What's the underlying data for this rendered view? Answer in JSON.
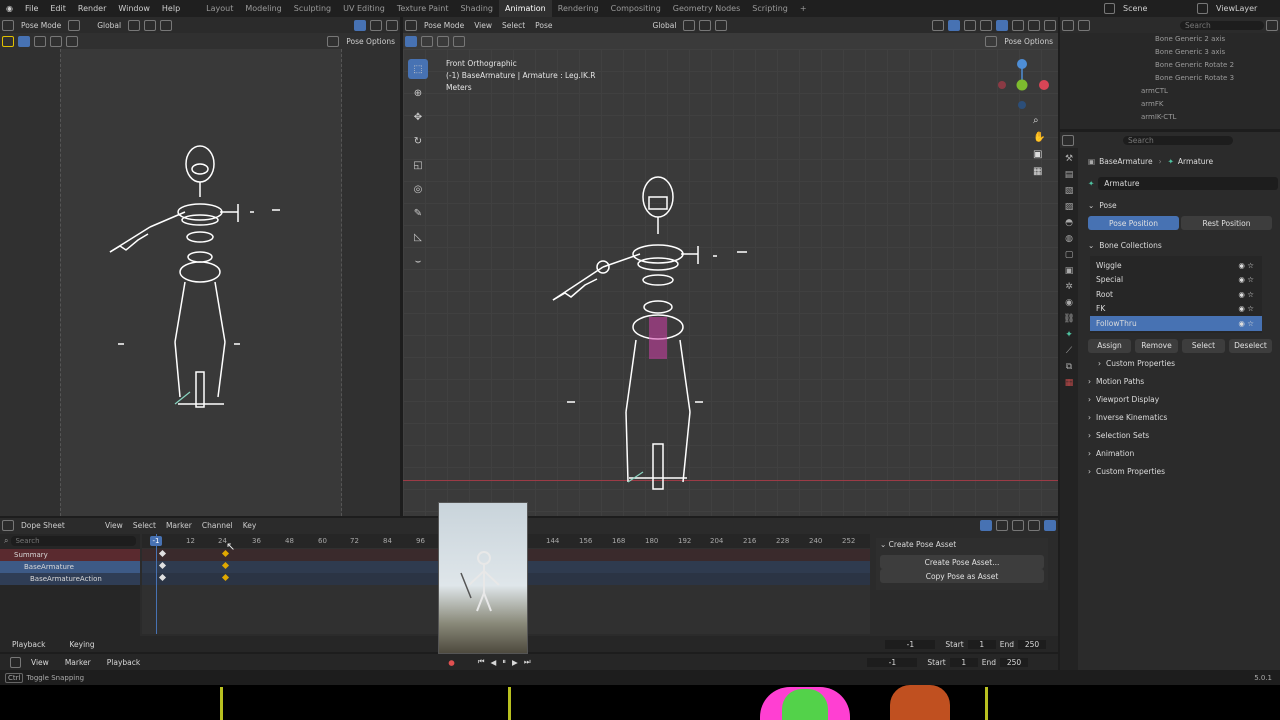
{
  "topbar": {
    "menus": [
      "File",
      "Edit",
      "Render",
      "Window",
      "Help"
    ],
    "workspaces": [
      "Layout",
      "Modeling",
      "Sculpting",
      "UV Editing",
      "Texture Paint",
      "Shading",
      "Animation",
      "Rendering",
      "Compositing",
      "Geometry Nodes",
      "Scripting"
    ],
    "active_workspace": "Animation",
    "add_tab": "+",
    "scene": "Scene",
    "view_layer": "ViewLayer"
  },
  "left_viewport": {
    "mode": "Pose Mode",
    "orientation": "Global",
    "pose_options": "Pose Options"
  },
  "main_viewport": {
    "mode": "Pose Mode",
    "menus": [
      "View",
      "Select",
      "Pose"
    ],
    "orientation": "Global",
    "pose_options": "Pose Options",
    "info_view": "Front Orthographic",
    "info_object": "(-1) BaseArmature | Armature : Leg.IK.R",
    "info_units": "Meters"
  },
  "outliner": {
    "search_placeholder": "Search",
    "items": [
      "Bone Generic 2 axis",
      "Bone Generic 3 axis",
      "Bone Generic Rotate 2",
      "Bone Generic Rotate 3",
      "armCTL",
      "armFK",
      "armIK-CTL"
    ]
  },
  "properties": {
    "search_placeholder": "Search",
    "breadcrumb_object": "BaseArmature",
    "breadcrumb_data": "Armature",
    "data_name": "Armature",
    "pose_panel": "Pose",
    "pose_position": "Pose Position",
    "rest_position": "Rest Position",
    "bone_collections_panel": "Bone Collections",
    "collections": [
      "Wiggle",
      "Special",
      "Root",
      "FK",
      "FollowThru"
    ],
    "selected_collection": "FollowThru",
    "assign": "Assign",
    "remove": "Remove",
    "select": "Select",
    "deselect": "Deselect",
    "custom_properties_sub": "Custom Properties",
    "panels": [
      "Motion Paths",
      "Viewport Display",
      "Inverse Kinematics",
      "Selection Sets",
      "Animation",
      "Custom Properties"
    ]
  },
  "dopesheet": {
    "editor_type": "Dope Sheet",
    "menus": [
      "View",
      "Select",
      "Marker",
      "Channel",
      "Key"
    ],
    "search_placeholder": "Search",
    "channels": [
      "Summary",
      "BaseArmature",
      "BaseArmatureAction"
    ],
    "current_frame_label": "-1",
    "ticks_left": [
      "12",
      "24",
      "36",
      "48",
      "60",
      "72",
      "84",
      "96"
    ],
    "ticks_right": [
      "144",
      "156",
      "168",
      "180",
      "192",
      "204",
      "216",
      "228",
      "240",
      "252"
    ],
    "asset_panel_title": "Create Pose Asset",
    "create_pose_asset": "Create Pose Asset...",
    "copy_pose_as_asset": "Copy Pose as Asset",
    "playback": "Playback",
    "keying": "Keying",
    "frame": "-1",
    "start_label": "Start",
    "start": "1",
    "end_label": "End",
    "end": "250"
  },
  "timeline": {
    "menus": [
      "View",
      "Marker",
      "Playback"
    ],
    "frame": "-1",
    "start_label": "Start",
    "start": "1",
    "end_label": "End",
    "end": "250"
  },
  "statusbar": {
    "hint_key": "Ctrl",
    "hint": "Toggle Snapping",
    "version": "5.0.1"
  },
  "colors": {
    "accent": "#4772b3",
    "bone_white": "#ffffff",
    "pose_magenta": "#d03fa8",
    "keyframe": "#e0a800"
  }
}
